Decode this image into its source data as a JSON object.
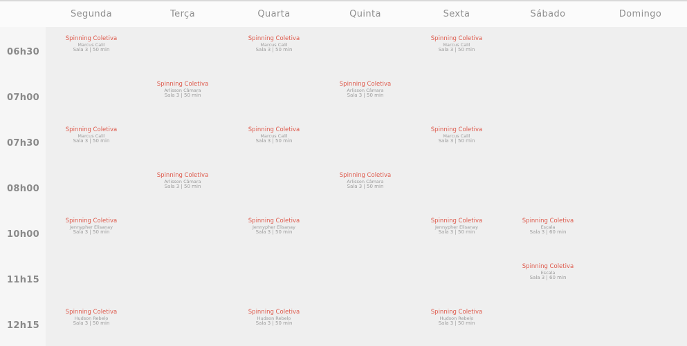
{
  "days": [
    "Segunda",
    "Terça",
    "Quarta",
    "Quinta",
    "Sexta",
    "Sábado",
    "Domingo"
  ],
  "rows": [
    {
      "time": "06h30",
      "cells": [
        {
          "name": "Spinning Coletiva",
          "instructor": "Marcus Calil",
          "room": "Sala 3 | 50 min"
        },
        null,
        {
          "name": "Spinning Coletiva",
          "instructor": "Marcus Calil",
          "room": "Sala 3 | 50 min"
        },
        null,
        {
          "name": "Spinning Coletiva",
          "instructor": "Marcus Calil",
          "room": "Sala 3 | 50 min"
        },
        null,
        null
      ]
    },
    {
      "time": "07h00",
      "cells": [
        null,
        {
          "name": "Spinning Coletiva",
          "instructor": "Arlisson Câmara",
          "room": "Sala 3 | 50 min"
        },
        null,
        {
          "name": "Spinning Coletiva",
          "instructor": "Arlisson Câmara",
          "room": "Sala 3 | 50 min"
        },
        null,
        null,
        null
      ]
    },
    {
      "time": "07h30",
      "cells": [
        {
          "name": "Spinning Coletiva",
          "instructor": "Marcus Calil",
          "room": "Sala 3 | 50 min"
        },
        null,
        {
          "name": "Spinning Coletiva",
          "instructor": "Marcus Calil",
          "room": "Sala 3 | 50 min"
        },
        null,
        {
          "name": "Spinning Coletiva",
          "instructor": "Marcus Calil",
          "room": "Sala 3 | 50 min"
        },
        null,
        null
      ]
    },
    {
      "time": "08h00",
      "cells": [
        null,
        {
          "name": "Spinning Coletiva",
          "instructor": "Arlisson Câmara",
          "room": "Sala 3 | 50 min"
        },
        null,
        {
          "name": "Spinning Coletiva",
          "instructor": "Arlisson Câmara",
          "room": "Sala 3 | 50 min"
        },
        null,
        null,
        null
      ]
    },
    {
      "time": "10h00",
      "cells": [
        {
          "name": "Spinning Coletiva",
          "instructor": "Jennypher Elisanay",
          "room": "Sala 3 | 50 min"
        },
        null,
        {
          "name": "Spinning Coletiva",
          "instructor": "Jennypher Elisanay",
          "room": "Sala 3 | 50 min"
        },
        null,
        {
          "name": "Spinning Coletiva",
          "instructor": "Jennypher Elisanay",
          "room": "Sala 3 | 50 min"
        },
        {
          "name": "Spinning Coletiva",
          "instructor": "Escala",
          "room": "Sala 3 | 60 min"
        },
        null
      ]
    },
    {
      "time": "11h15",
      "cells": [
        null,
        null,
        null,
        null,
        null,
        {
          "name": "Spinning Coletiva",
          "instructor": "Escala",
          "room": "Sala 3 | 60 min"
        },
        null
      ]
    },
    {
      "time": "12h15",
      "cells": [
        {
          "name": "Spinning Coletiva",
          "instructor": "Hudson Rebelo",
          "room": "Sala 3 | 50 min"
        },
        null,
        {
          "name": "Spinning Coletiva",
          "instructor": "Hudson Rebelo",
          "room": "Sala 3 | 50 min"
        },
        null,
        {
          "name": "Spinning Coletiva",
          "instructor": "Hudson Rebelo",
          "room": "Sala 3 | 50 min"
        },
        null,
        null
      ]
    }
  ]
}
